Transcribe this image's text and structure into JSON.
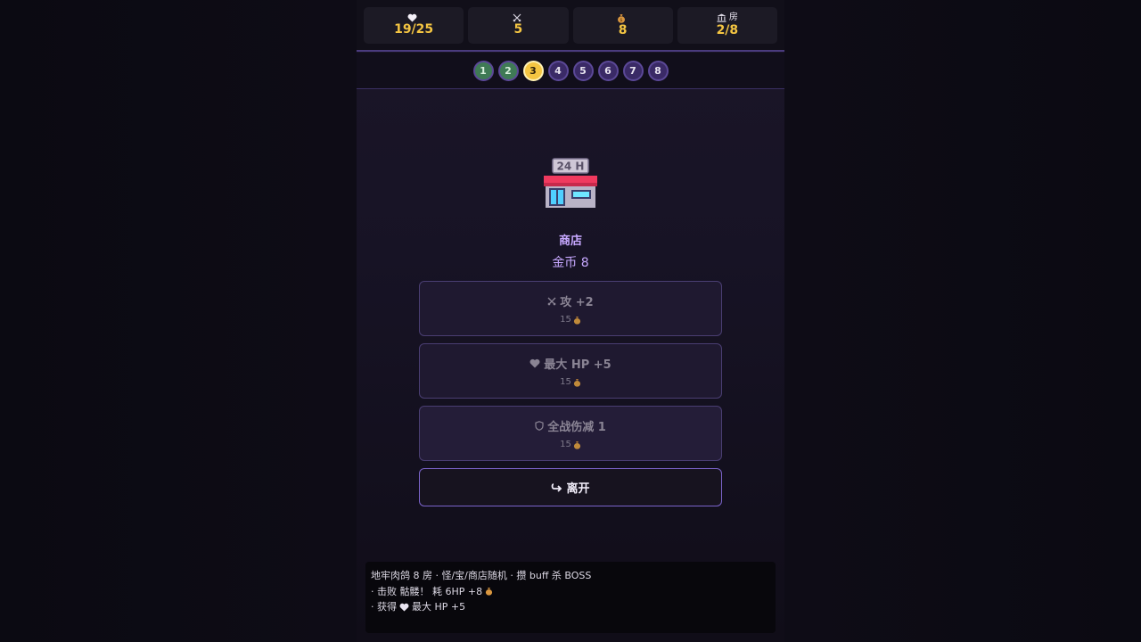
{
  "stats": [
    {
      "icon": "heart-icon",
      "label": "",
      "value": "19/25"
    },
    {
      "icon": "swords-icon",
      "label": "",
      "value": "5"
    },
    {
      "icon": "money-bag-icon",
      "label": "",
      "value": "8"
    },
    {
      "icon": "bank-icon",
      "label": "房",
      "value": "2/8"
    }
  ],
  "rooms": [
    {
      "num": "1",
      "state": "done"
    },
    {
      "num": "2",
      "state": "done"
    },
    {
      "num": "3",
      "state": "current"
    },
    {
      "num": "4",
      "state": "locked"
    },
    {
      "num": "5",
      "state": "locked"
    },
    {
      "num": "6",
      "state": "locked"
    },
    {
      "num": "7",
      "state": "locked"
    },
    {
      "num": "8",
      "state": "locked"
    }
  ],
  "scene": {
    "icon": "convenience-store-icon",
    "sign": "24 H",
    "title": "商店",
    "gold_text": "金币 8"
  },
  "options": [
    {
      "icon": "swords-icon",
      "label": "攻 +2",
      "cost": "15",
      "cost_icon": "money-bag-icon"
    },
    {
      "icon": "heart-icon",
      "label": "最大 HP +5",
      "cost": "15",
      "cost_icon": "money-bag-icon"
    },
    {
      "icon": "shield-icon",
      "label": "全战伤减 1",
      "cost": "15",
      "cost_icon": "money-bag-icon"
    }
  ],
  "leave": {
    "icon": "return-arrow-icon",
    "label": "离开"
  },
  "log": {
    "line1": "地牢肉鸽 8 房 · 怪/宝/商店随机 · 攒 buff 杀 BOSS",
    "line2_prefix": "· 击败 骷髅！ 耗 6HP +8",
    "line3_prefix": "· 获得",
    "line3_suffix": "最大 HP +5"
  },
  "colors": {
    "accent": "#f4c542",
    "purple": "#c7a8ff",
    "border": "#4a3b7e",
    "done": "#3f7a55"
  }
}
